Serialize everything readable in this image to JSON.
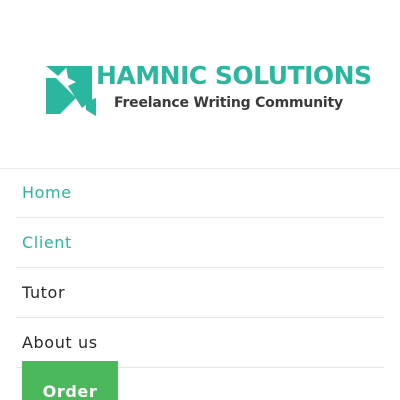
{
  "logo": {
    "title": "HAMNIC SOLUTIONS",
    "subtitle": "Freelance Writing Community",
    "icon": "hamnic-logo-mark",
    "colors": {
      "primary": "#2bb6a0",
      "text": "#3a3a3a"
    }
  },
  "nav": {
    "items": [
      {
        "label": "Home",
        "color": "#2bb6a0"
      },
      {
        "label": "Client",
        "color": "#2bb6a0"
      },
      {
        "label": "Tutor",
        "color": "#2a2a2a"
      },
      {
        "label": "About us",
        "color": "#2a2a2a"
      }
    ]
  },
  "order_button": {
    "label": "Order",
    "color": "#4bb85c"
  }
}
